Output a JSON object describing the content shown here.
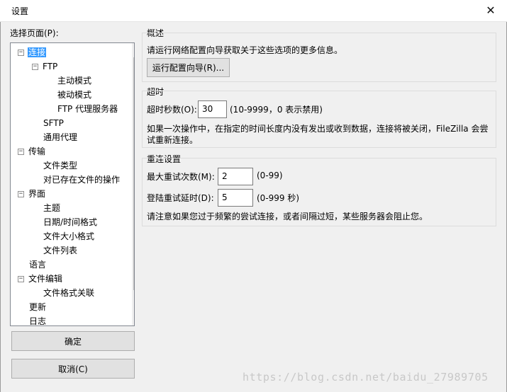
{
  "window": {
    "title": "设置",
    "close_glyph": "✕"
  },
  "tree": {
    "label": "选择页面(P):",
    "items": [
      {
        "label": "连接",
        "level": 0,
        "expander": "-",
        "selected": true
      },
      {
        "label": "FTP",
        "level": 1,
        "expander": "-"
      },
      {
        "label": "主动模式",
        "level": 2
      },
      {
        "label": "被动模式",
        "level": 2
      },
      {
        "label": "FTP 代理服务器",
        "level": 2
      },
      {
        "label": "SFTP",
        "level": 1
      },
      {
        "label": "通用代理",
        "level": 1
      },
      {
        "label": "传输",
        "level": 0,
        "expander": "-"
      },
      {
        "label": "文件类型",
        "level": 1
      },
      {
        "label": "对已存在文件的操作",
        "level": 1
      },
      {
        "label": "界面",
        "level": 0,
        "expander": "-"
      },
      {
        "label": "主题",
        "level": 1
      },
      {
        "label": "日期/时间格式",
        "level": 1
      },
      {
        "label": "文件大小格式",
        "level": 1
      },
      {
        "label": "文件列表",
        "level": 1
      },
      {
        "label": "语言",
        "level": 0
      },
      {
        "label": "文件编辑",
        "level": 0,
        "expander": "-"
      },
      {
        "label": "文件格式关联",
        "level": 1
      },
      {
        "label": "更新",
        "level": 0
      },
      {
        "label": "日志",
        "level": 0
      }
    ],
    "scroll_up": "▲",
    "scroll_down": "▼"
  },
  "buttons": {
    "ok": "确定",
    "cancel": "取消(C)"
  },
  "overview": {
    "title": "概述",
    "text": "请运行网络配置向导获取关于这些选项的更多信息。",
    "wizard_button": "运行配置向导(R)..."
  },
  "timeout": {
    "title": "超时",
    "label": "超时秒数(O):",
    "value": "30",
    "hint": "(10-9999，0 表示禁用)",
    "desc_line1": "如果一次操作中，在指定的时间长度内没有发出或收到数据，连接将被关闭，FileZilla 会尝",
    "desc_line2": "试重新连接。"
  },
  "reconnect": {
    "title": "重连设置",
    "retries_label": "最大重试次数(M):",
    "retries_value": "2",
    "retries_hint": "(0-99)",
    "delay_label": "登陆重试延时(D):",
    "delay_value": "5",
    "delay_hint": "(0-999 秒)",
    "note": "请注意如果您过于频繁的尝试连接，或者间隔过短，某些服务器会阻止您。"
  },
  "watermark": "https://blog.csdn.net/baidu_27989705"
}
